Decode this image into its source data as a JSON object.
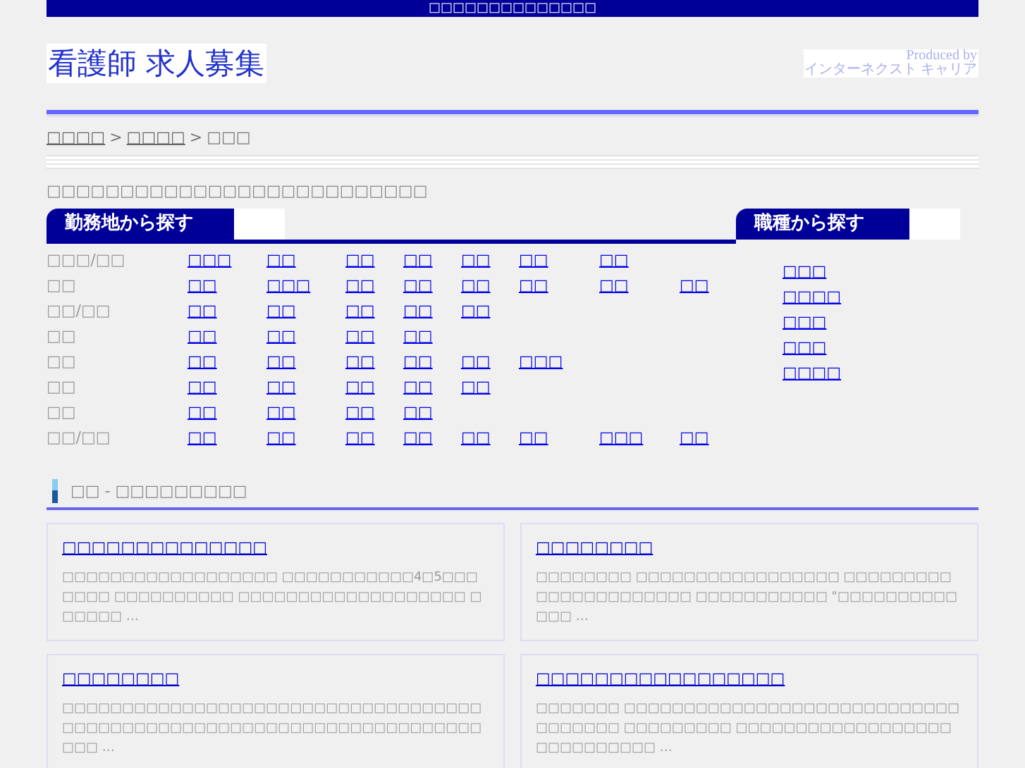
{
  "top_bar": {
    "text": "□□□□□□□□□□□□□□"
  },
  "header": {
    "logo": "看護師 求人募集",
    "producer_line1": "Produced by",
    "producer_line2": "インターネクスト キャリア"
  },
  "breadcrumb_separator": ">",
  "breadcrumb": [
    {
      "label": "□□□□",
      "link": true
    },
    {
      "label": "□□□□",
      "link": true
    },
    {
      "label": "□□□",
      "link": false
    }
  ],
  "intro": "□□□□□□□□□□□□□□□□□□□□□□□□□□",
  "area_search": {
    "title": "勤務地から探す",
    "rows": [
      {
        "region": "□□□/□□",
        "prefectures": [
          "□□□",
          "□□",
          "□□",
          "□□",
          "□□",
          "□□",
          "□□"
        ]
      },
      {
        "region": "□□",
        "prefectures": [
          "□□",
          "□□□",
          "□□",
          "□□",
          "□□",
          "□□",
          "□□",
          "□□"
        ]
      },
      {
        "region": "□□/□□",
        "prefectures": [
          "□□",
          "□□",
          "□□",
          "□□",
          "□□"
        ]
      },
      {
        "region": "□□",
        "prefectures": [
          "□□",
          "□□",
          "□□",
          "□□"
        ]
      },
      {
        "region": "□□",
        "prefectures": [
          "□□",
          "□□",
          "□□",
          "□□",
          "□□",
          "□□□"
        ]
      },
      {
        "region": "□□",
        "prefectures": [
          "□□",
          "□□",
          "□□",
          "□□",
          "□□"
        ]
      },
      {
        "region": "□□",
        "prefectures": [
          "□□",
          "□□",
          "□□",
          "□□"
        ]
      },
      {
        "region": "□□/□□",
        "prefectures": [
          "□□",
          "□□",
          "□□",
          "□□",
          "□□",
          "□□",
          "□□□",
          "□□"
        ]
      }
    ]
  },
  "job_search": {
    "title": "職種から探す",
    "items": [
      "□□□",
      "□□□□",
      "□□□",
      "□□□",
      "□□□□"
    ]
  },
  "news": {
    "heading": "□□ - □□□□□□□□□",
    "cards": [
      {
        "title": "□□□□□□□□□□□□□□",
        "body": "□□□□□□□□□□□□□□□□□□ □□□□□□□□□□□4□5□□□□□□□ □□□□□□□□□□ □□□□□□□□□□□□□□□□□□□ □□□□□□ …"
      },
      {
        "title": "□□□□□□□□",
        "body": "□□□□□□□□ □□□□□□□□□□□□□□□□□ □□□□□□□□□□□□□□□□□□□□□□ □□□□□□□□□□□ \"□□□□□□□□□□□□□ …"
      },
      {
        "title": "□□□□□□□□",
        "body": "□□□□□□□□□□□□□□□□□□□□□□□□□□□□□□□□□□□□□□□□□□□□□□□□□□□□□□□□□□□□□□□□□□□□□□□□□ …"
      },
      {
        "title": "□□□□□□□□□□□□□□□□□",
        "body": "□□□□□□□ □□□□□□□□□□□□□□□□□□□□□□□□□□□□□□□□□□□ □□□□□□□□□ □□□□□□□□□□□□□□□□□□□□□□□□□□□□ …"
      }
    ]
  }
}
